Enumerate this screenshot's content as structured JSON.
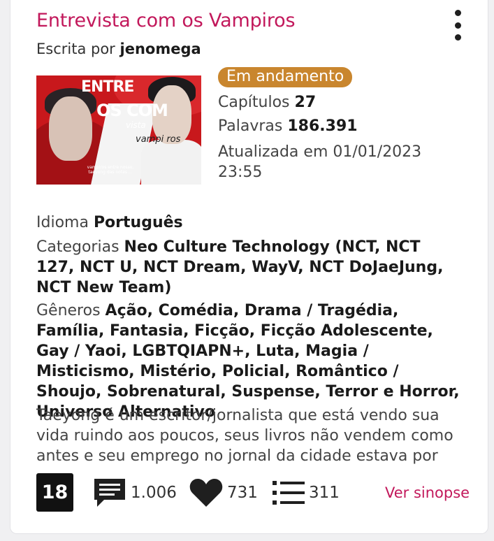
{
  "story": {
    "title": "Entrevista com os Vampiros",
    "author_prefix": "Escrita por",
    "author": "jenomega",
    "status": "Em andamento",
    "chapters_label": "Capítulos",
    "chapters": "27",
    "words_label": "Palavras",
    "words": "186.391",
    "updated_label": "Atualizada em",
    "updated": "01/01/2023 23:55",
    "language_label": "Idioma",
    "language": "Português",
    "categories_label": "Categorias",
    "categories": "Neo Culture Technology (NCT, NCT 127, NCT U, NCT Dream, WayV, NCT DoJaeJung, NCT New Team)",
    "genres_label": "Gêneros",
    "genres": "Ação, Comédia, Drama / Tragédia, Família, Fantasia, Ficção, Ficção Adolescente, Gay / Yaoi, LGBTQIAPN+, Luta, Magia / Misticismo, Mistério, Policial, Romântico / Shoujo, Sobrenatural, Suspense, Terror e Horror, Universo Alternativo",
    "synopsis": "Taeyong é um escritor/jornalista que está vendo sua vida ruindo aos poucos, seus livros não vendem como antes e seu emprego no jornal da cidade estava por"
  },
  "cover": {
    "line1": "ENTRE",
    "line2": "OS COM",
    "line3": "vista",
    "line4": "vampi ros",
    "small": "vampiros entre nosso, taeyong das notas ..."
  },
  "footer": {
    "age_rating": "18",
    "comments": "1.006",
    "favorites": "731",
    "lists": "311",
    "synopsis_button": "Ver sinopse"
  },
  "colors": {
    "accent": "#c2185b",
    "status_badge": "#c9862e",
    "cover_red": "#c8181c"
  },
  "icons": [
    "more-vert-icon",
    "comment-icon",
    "heart-icon",
    "list-icon"
  ]
}
